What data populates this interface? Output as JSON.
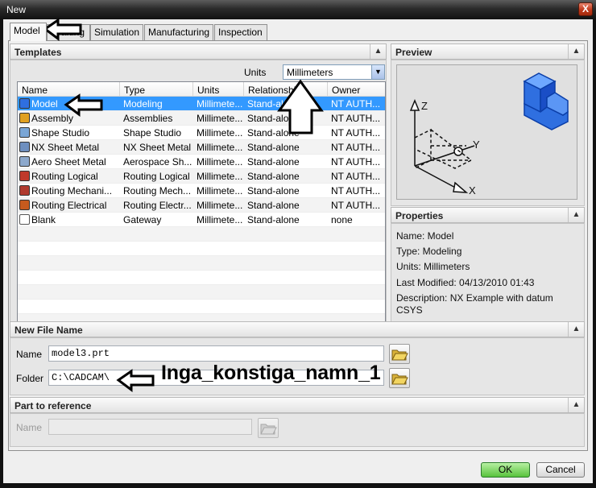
{
  "window": {
    "title": "New",
    "close_label": "X"
  },
  "tabs": [
    {
      "label": "Model"
    },
    {
      "label": "Drafting"
    },
    {
      "label": "Simulation"
    },
    {
      "label": "Manufacturing"
    },
    {
      "label": "Inspection"
    }
  ],
  "templates": {
    "header": "Templates",
    "units_label": "Units",
    "units_value": "Millimeters",
    "columns": [
      "Name",
      "Type",
      "Units",
      "Relationship",
      "Owner"
    ],
    "rows": [
      {
        "name": "Model",
        "type": "Modeling",
        "units": "Millimete...",
        "relationship": "Stand-alone",
        "owner": "NT AUTH...",
        "icon": "model-icon"
      },
      {
        "name": "Assembly",
        "type": "Assemblies",
        "units": "Millimete...",
        "relationship": "Stand-alone",
        "owner": "NT AUTH...",
        "icon": "assembly-icon"
      },
      {
        "name": "Shape Studio",
        "type": "Shape Studio",
        "units": "Millimete...",
        "relationship": "Stand-alone",
        "owner": "NT AUTH...",
        "icon": "shape-studio-icon"
      },
      {
        "name": "NX Sheet Metal",
        "type": "NX Sheet Metal",
        "units": "Millimete...",
        "relationship": "Stand-alone",
        "owner": "NT AUTH...",
        "icon": "sheet-metal-icon"
      },
      {
        "name": "Aero Sheet Metal",
        "type": "Aerospace Sh...",
        "units": "Millimete...",
        "relationship": "Stand-alone",
        "owner": "NT AUTH...",
        "icon": "aero-sheet-metal-icon"
      },
      {
        "name": "Routing Logical",
        "type": "Routing Logical",
        "units": "Millimete...",
        "relationship": "Stand-alone",
        "owner": "NT AUTH...",
        "icon": "routing-logical-icon"
      },
      {
        "name": "Routing Mechani...",
        "type": "Routing Mech...",
        "units": "Millimete...",
        "relationship": "Stand-alone",
        "owner": "NT AUTH...",
        "icon": "routing-mechanical-icon"
      },
      {
        "name": "Routing Electrical",
        "type": "Routing Electr...",
        "units": "Millimete...",
        "relationship": "Stand-alone",
        "owner": "NT AUTH...",
        "icon": "routing-electrical-icon"
      },
      {
        "name": "Blank",
        "type": "Gateway",
        "units": "Millimete...",
        "relationship": "Stand-alone",
        "owner": "none",
        "icon": "blank-document-icon"
      }
    ]
  },
  "preview": {
    "header": "Preview",
    "axis_labels": {
      "z": "Z",
      "y": "Y",
      "x": "X"
    }
  },
  "properties": {
    "header": "Properties",
    "name": "Name: Model",
    "type": "Type: Modeling",
    "units": "Units: Millimeters",
    "last_modified": "Last Modified: 04/13/2010 01:43",
    "description_line1": "Description: NX Example with datum",
    "description_line2": "CSYS"
  },
  "new_file": {
    "header": "New File Name",
    "name_label": "Name",
    "name_value": "model3.prt",
    "folder_label": "Folder",
    "folder_value": "C:\\CADCAM\\"
  },
  "part_reference": {
    "header": "Part to reference",
    "name_label": "Name"
  },
  "annotation_text": "Inga_konstiga_namn_1",
  "buttons": {
    "ok": "OK",
    "cancel": "Cancel"
  },
  "colors": {
    "selection": "#3399ff",
    "ok_button": "#58c23c",
    "close_button": "#c0391b"
  }
}
